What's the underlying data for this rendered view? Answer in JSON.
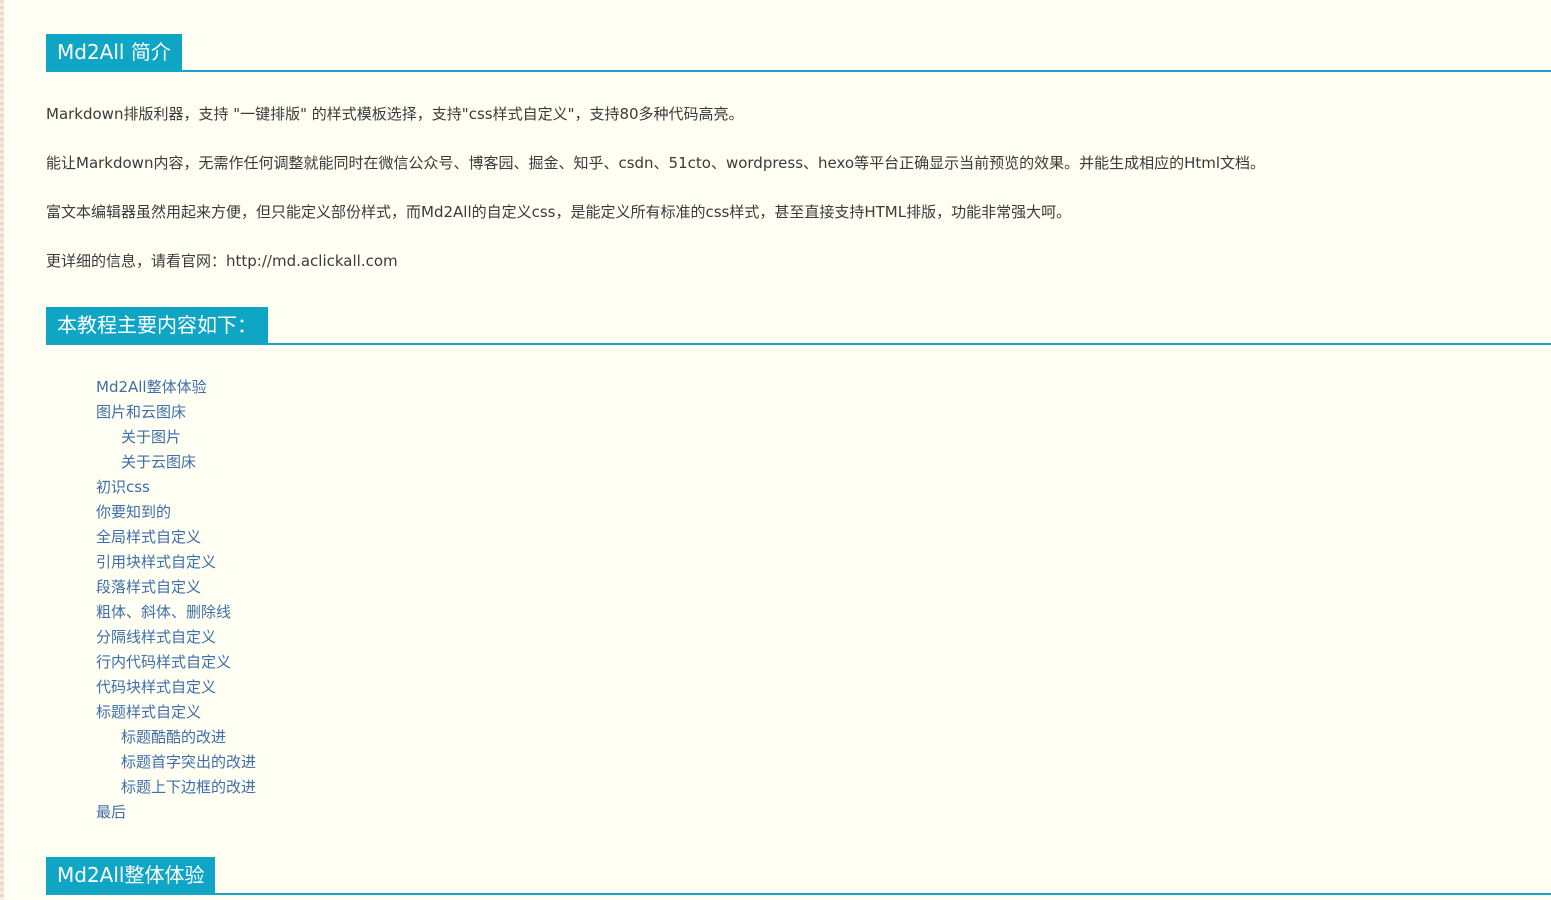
{
  "sections": [
    {
      "title": "Md2All 简介"
    },
    {
      "title": "本教程主要内容如下："
    },
    {
      "title": "Md2All整体体验"
    }
  ],
  "intro": {
    "paragraphs": [
      "Markdown排版利器，支持 \"一键排版\" 的样式模板选择，支持\"css样式自定义\"，支持80多种代码高亮。",
      "能让Markdown内容，无需作任何调整就能同时在微信公众号、博客园、掘金、知乎、csdn、51cto、wordpress、hexo等平台正确显示当前预览的效果。并能生成相应的Html文档。",
      "富文本编辑器虽然用起来方便，但只能定义部份样式，而Md2All的自定义css，是能定义所有标准的css样式，甚至直接支持HTML排版，功能非常强大呵。",
      "更详细的信息，请看官网：http://md.aclickall.com"
    ]
  },
  "toc": {
    "items": [
      {
        "label": "Md2All整体体验",
        "level": 1
      },
      {
        "label": "图片和云图床",
        "level": 1
      },
      {
        "label": "关于图片",
        "level": 2
      },
      {
        "label": "关于云图床",
        "level": 2
      },
      {
        "label": "初识css",
        "level": 1
      },
      {
        "label": "你要知到的",
        "level": 1
      },
      {
        "label": "全局样式自定义",
        "level": 1
      },
      {
        "label": "引用块样式自定义",
        "level": 1
      },
      {
        "label": "段落样式自定义",
        "level": 1
      },
      {
        "label": "粗体、斜体、删除线",
        "level": 1
      },
      {
        "label": "分隔线样式自定义",
        "level": 1
      },
      {
        "label": "行内代码样式自定义",
        "level": 1
      },
      {
        "label": "代码块样式自定义",
        "level": 1
      },
      {
        "label": "标题样式自定义",
        "level": 1
      },
      {
        "label": "标题酷酷的改进",
        "level": 2
      },
      {
        "label": "标题首字突出的改进",
        "level": 2
      },
      {
        "label": "标题上下边框的改进",
        "level": 2
      },
      {
        "label": "最后",
        "level": 1
      }
    ]
  },
  "colors": {
    "heading_bg": "#0fa5c5",
    "heading_line": "#1aa5c6",
    "page_bg": "#fefef3",
    "link": "#3f6fa9",
    "text": "#3b3b3b"
  }
}
